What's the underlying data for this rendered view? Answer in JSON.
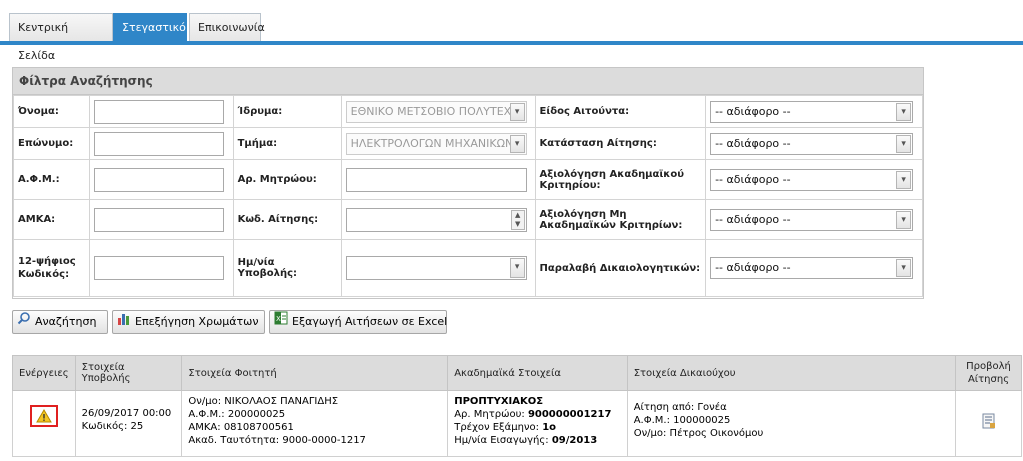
{
  "tabs": [
    {
      "label": "Κεντρική Σελίδα"
    },
    {
      "label": "Στεγαστικό"
    },
    {
      "label": "Επικοινωνία"
    }
  ],
  "filters": {
    "title": "Φίλτρα Αναζήτησης",
    "name_label": "Όνομα:",
    "surname_label": "Επώνυμο:",
    "afm_label": "Α.Φ.Μ.:",
    "amka_label": "ΑΜΚΑ:",
    "code12_label": "12-ψήφιος Κωδικός:",
    "institution_label": "Ίδρυμα:",
    "institution_value": "ΕΘΝΙΚΟ ΜΕΤΣΟΒΙΟ ΠΟΛΥΤΕΧ",
    "department_label": "Τμήμα:",
    "department_value": "ΗΛΕΚΤΡΟΛΟΓΩΝ ΜΗΧΑΝΙΚΩΝ",
    "registry_label": "Αρ. Μητρώου:",
    "appcode_label": "Κωδ. Αίτησης:",
    "submitdate_label": "Ημ/νία Υποβολής:",
    "applicant_type_label": "Είδος Αιτούντα:",
    "status_label": "Κατάσταση Αίτησης:",
    "academic_eval_label": "Αξιολόγηση Ακαδημαϊκού Κριτηρίου:",
    "nonacademic_eval_label": "Αξιολόγηση Μη Ακαδημαϊκών Κριτηρίων:",
    "docs_received_label": "Παραλαβή Δικαιολογητικών:",
    "any_option": "-- αδιάφορο --"
  },
  "buttons": {
    "search": "Αναζήτηση",
    "colors": "Επεξήγηση Χρωμάτων",
    "export": "Εξαγωγή Αιτήσεων σε Excel"
  },
  "results": {
    "headers": [
      "Ενέργειες",
      "Στοιχεία Υποβολής",
      "Στοιχεία Φοιτητή",
      "Ακαδημαϊκά Στοιχεία",
      "Στοιχεία Δικαιούχου",
      "Προβολή Αίτησης"
    ],
    "rows": [
      {
        "submission": {
          "date": "26/09/2017 00:00",
          "code": "Κωδικός: 25"
        },
        "student": {
          "name": "Ον/μο: ΝΙΚΟΛΑΟΣ ΠΑΝΑΓΙΔΗΣ",
          "afm": "Α.Φ.Μ.: 200000025",
          "amka": "ΑΜΚΑ: 08108700561",
          "id": "Ακαδ. Ταυτότητα: 9000-0000-1217"
        },
        "academic": {
          "level": "ΠΡΟΠΤΥΧΙΑΚΟΣ",
          "registry_label": "Αρ. Μητρώου: ",
          "registry_value": "900000001217",
          "semester_label": "Τρέχον Εξάμηνο: ",
          "semester_value": "1ο",
          "entry_label": "Ημ/νία Εισαγωγής: ",
          "entry_value": "09/2013"
        },
        "beneficiary": {
          "applicant": "Αίτηση από: Γονέα",
          "afm": "Α.Φ.Μ.: 100000025",
          "name": "Ον/μο: Πέτρος Οικονόμου"
        }
      }
    ]
  },
  "colors": {
    "accent": "#2f86c8",
    "warning_border": "#e02020",
    "warning_fill": "#f3c623"
  }
}
